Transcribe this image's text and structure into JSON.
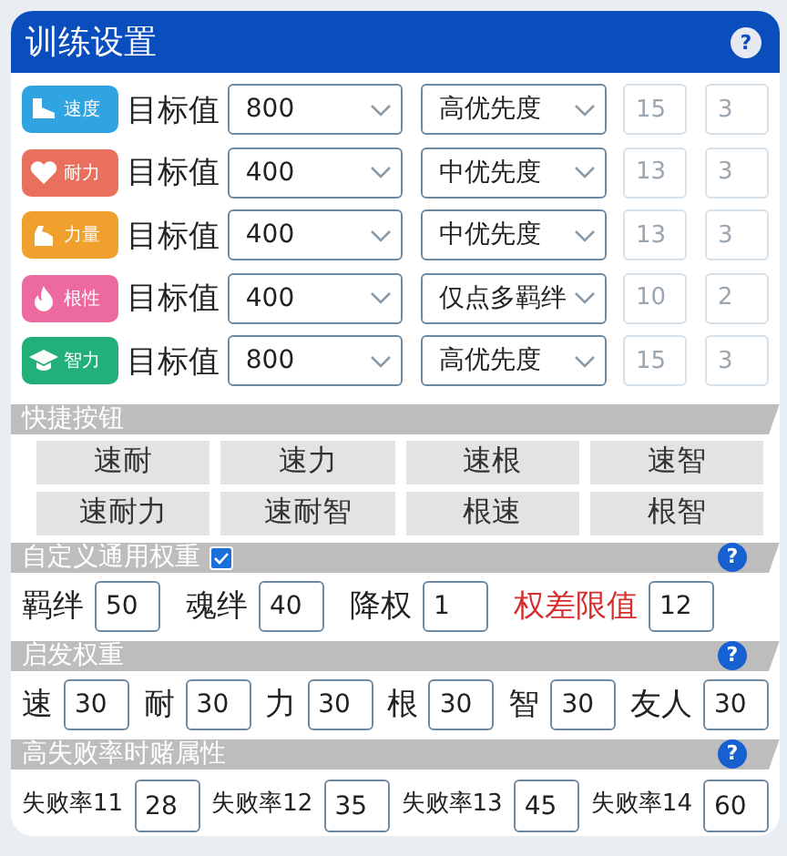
{
  "window": {
    "title": "训练设置",
    "help": "?"
  },
  "stats": [
    {
      "badge": "速度",
      "color": "#2fa4e0",
      "label": "目标值",
      "target": "800",
      "priority": "高优先度",
      "values": [
        {
          "placeholder": "15",
          "disabled": true
        },
        {
          "placeholder": "3",
          "disabled": true
        }
      ]
    },
    {
      "badge": "耐力",
      "color": "#e8705c",
      "label": "目标值",
      "target": "400",
      "priority": "中优先度",
      "values": [
        {
          "placeholder": "13",
          "disabled": true
        },
        {
          "placeholder": "3",
          "disabled": true
        }
      ]
    },
    {
      "badge": "力量",
      "color": "#f0a02c",
      "label": "目标值",
      "target": "400",
      "priority": "中优先度",
      "values": [
        {
          "placeholder": "13",
          "disabled": true
        },
        {
          "placeholder": "3",
          "disabled": true
        }
      ]
    },
    {
      "badge": "根性",
      "color": "#ec6aa0",
      "label": "目标值",
      "target": "400",
      "priority": "仅点多羁绊",
      "values": [
        {
          "placeholder": "10",
          "disabled": true
        },
        {
          "placeholder": "2",
          "disabled": true
        }
      ]
    },
    {
      "badge": "智力",
      "color": "#22b07a",
      "label": "目标值",
      "target": "800",
      "priority": "高优先度",
      "values": [
        {
          "placeholder": "15",
          "disabled": true
        },
        {
          "placeholder": "3",
          "disabled": true
        }
      ]
    }
  ],
  "quick_buttons": {
    "title": "快捷按钮",
    "buttons": [
      "速耐",
      "速力",
      "速根",
      "速智",
      "速耐力",
      "速耐智",
      "根速",
      "根智"
    ]
  },
  "custom_weights": {
    "title": "自定义通用权重",
    "checked": true,
    "help": "?",
    "fields": [
      {
        "label": "羁绊",
        "value": "50",
        "kind": "normal"
      },
      {
        "label": "魂绊",
        "value": "40",
        "kind": "normal"
      },
      {
        "label": "降权",
        "value": "1",
        "kind": "normal"
      },
      {
        "label": "权差限值",
        "value": "12",
        "kind": "warning"
      }
    ]
  },
  "heuristic_weights": {
    "title": "启发权重",
    "help": "?",
    "fields": [
      {
        "label": "速",
        "value": "30",
        "kind": "normal"
      },
      {
        "label": "耐",
        "value": "30",
        "kind": "normal"
      },
      {
        "label": "力",
        "value": "30",
        "kind": "normal"
      },
      {
        "label": "根",
        "value": "30",
        "kind": "normal"
      },
      {
        "label": "智",
        "value": "30",
        "kind": "normal"
      },
      {
        "label": "友人",
        "value": "30",
        "kind": "normal"
      }
    ]
  },
  "high_fail": {
    "title": "高失败率时赌属性",
    "help": "?",
    "fields": [
      {
        "label": "失败率11",
        "value": "28",
        "kind": "small"
      },
      {
        "label": "失败率12",
        "value": "35",
        "kind": "small"
      },
      {
        "label": "失败率13",
        "value": "45",
        "kind": "small"
      },
      {
        "label": "失败率14",
        "value": "60",
        "kind": "small"
      }
    ]
  }
}
